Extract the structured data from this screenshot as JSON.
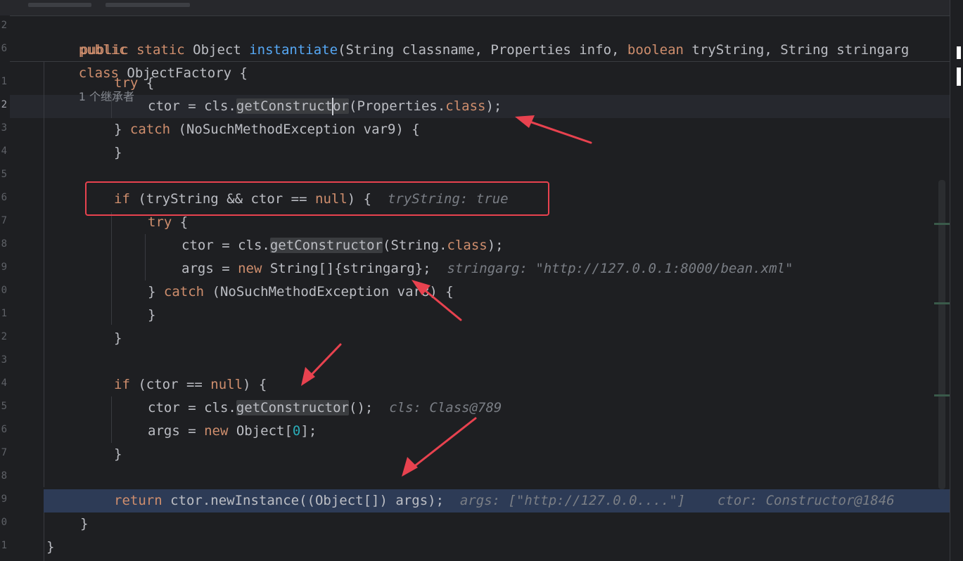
{
  "editor": {
    "line_numbers": [
      "2",
      "6",
      "",
      "1",
      "2",
      "3",
      "4",
      "5",
      "6",
      "7",
      "8",
      "9",
      "0",
      "1",
      "2",
      "3",
      "4",
      "5",
      "6",
      "7",
      "8",
      "9",
      "0",
      "1"
    ],
    "sticky": {
      "class_decl": {
        "kw_public": "public",
        "kw_class": "class",
        "class_name": " ObjectFactory {",
        "inherit_hint": "1 个继承者"
      },
      "method_decl": {
        "kw_public_static": "public static",
        "ret": " Object ",
        "name": "instantiate",
        "p1": "(String classname, Properties info, ",
        "kw_boolean": "boolean",
        "p2": " tryString, String stringarg"
      }
    },
    "lines": {
      "try1": "try",
      "try1_rest": " {",
      "l2_a": "ctor = cls.",
      "l2_fn": "getConstructor",
      "l2_b": "(Properties.",
      "l2_kw": "class",
      "l2_c": ");",
      "l3_a": "} ",
      "l3_kw": "catch",
      "l3_b": " (NoSuchMethodException var9) {",
      "l4": "}",
      "l6_kw": "if",
      "l6_a": " (tryString && ctor == ",
      "l6_null": "null",
      "l6_b": ") {",
      "l6_hint": "tryString: true",
      "l7_kw": "try",
      "l7_b": " {",
      "l8_a": "ctor = cls.",
      "l8_fn": "getConstructor",
      "l8_b": "(String.",
      "l8_kw": "class",
      "l8_c": ");",
      "l9_a": "args = ",
      "l9_kw": "new",
      "l9_b": " String[]{stringarg};",
      "l9_hint": "stringarg: \"http://127.0.0.1:8000/bean.xml\"",
      "l10_a": "} ",
      "l10_kw": "catch",
      "l10_b": " (NoSuchMethodException var8) {",
      "l11": "}",
      "l12": "}",
      "l14_kw": "if",
      "l14_a": " (ctor == ",
      "l14_null": "null",
      "l14_b": ") {",
      "l15_a": "ctor = cls.",
      "l15_fn": "getConstructor",
      "l15_b": "();",
      "l15_hint": "cls: Class@789",
      "l16_a": "args = ",
      "l16_kw": "new",
      "l16_b": " Object[",
      "l16_num": "0",
      "l16_c": "];",
      "l17": "}",
      "l19_kw": "return",
      "l19_a": " ctor.newInstance((Object[]) args);",
      "l19_hint1": "args: [\"http://127.0.0....\"]",
      "l19_hint2": "ctor: Constructor@1846",
      "l20": "}",
      "l21": "}"
    }
  },
  "colors": {
    "background": "#1e1f22",
    "keyword": "#cf8e6d",
    "function": "#56a8f5",
    "number": "#2aacb8",
    "inlay_hint": "#7a7e85",
    "execution_line": "#2d3b56",
    "annotation_red": "#e8424f"
  }
}
